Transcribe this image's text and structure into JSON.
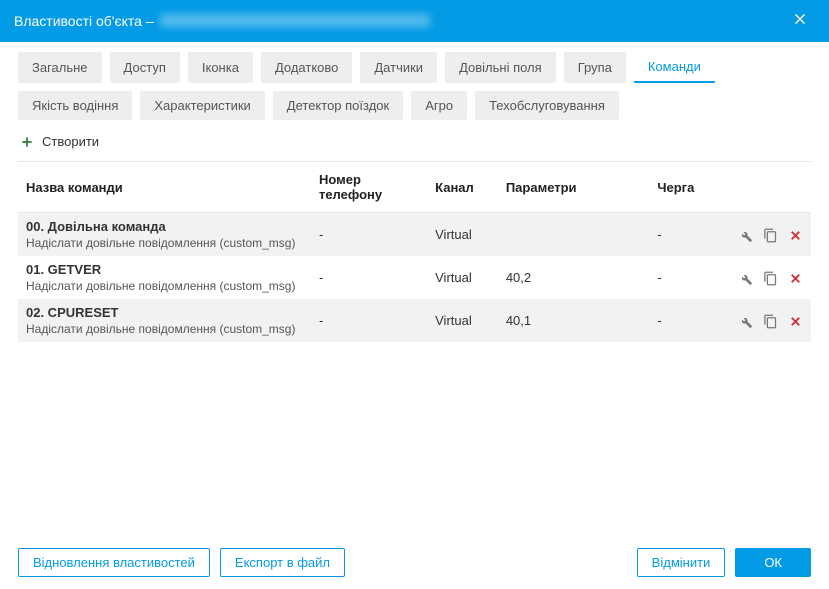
{
  "header": {
    "title": "Властивості об'єкта –"
  },
  "tabs": [
    {
      "label": "Загальне"
    },
    {
      "label": "Доступ"
    },
    {
      "label": "Іконка"
    },
    {
      "label": "Додатково"
    },
    {
      "label": "Датчики"
    },
    {
      "label": "Довільні поля"
    },
    {
      "label": "Група"
    },
    {
      "label": "Команди",
      "active": true
    },
    {
      "label": "Якість водіння"
    },
    {
      "label": "Характеристики"
    },
    {
      "label": "Детектор поїздок"
    },
    {
      "label": "Агро"
    },
    {
      "label": "Техобслуговування"
    }
  ],
  "toolbar": {
    "create_label": "Створити"
  },
  "table": {
    "headers": {
      "name": "Назва команди",
      "phone": "Номер телефону",
      "channel": "Канал",
      "params": "Параметри",
      "queue": "Черга"
    },
    "rows": [
      {
        "name": "00. Довільна команда",
        "desc": "Надіслати довільне повідомлення (custom_msg)",
        "phone": "-",
        "channel": "Virtual",
        "params": "",
        "queue": "-"
      },
      {
        "name": "01. GETVER",
        "desc": "Надіслати довільне повідомлення (custom_msg)",
        "phone": "-",
        "channel": "Virtual",
        "params": "40,2",
        "queue": "-"
      },
      {
        "name": "02. CPURESET",
        "desc": "Надіслати довільне повідомлення (custom_msg)",
        "phone": "-",
        "channel": "Virtual",
        "params": "40,1",
        "queue": "-"
      }
    ]
  },
  "footer": {
    "restore_label": "Відновлення властивостей",
    "export_label": "Експорт в файл",
    "cancel_label": "Відмінити",
    "ok_label": "ОК"
  }
}
